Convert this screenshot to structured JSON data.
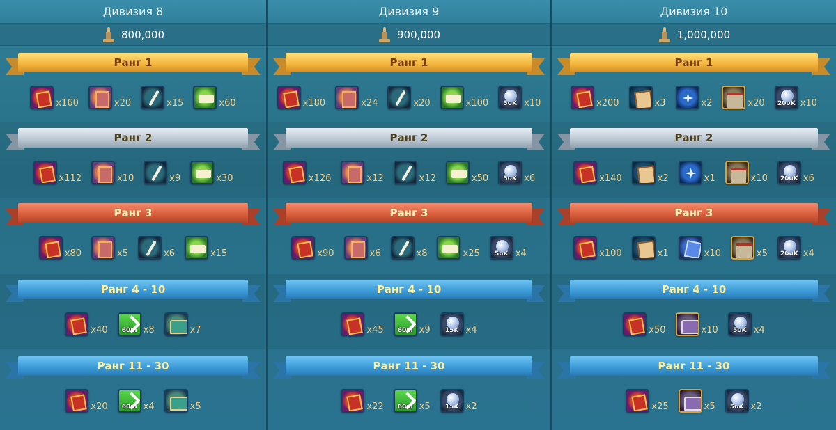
{
  "columns": [
    {
      "title": "Дивизия 8",
      "requirement": "800,000",
      "tiers": [
        {
          "label": "Ранг 1",
          "style": "gold",
          "items": [
            {
              "icon": "redbook",
              "qty": "x160"
            },
            {
              "icon": "pinkbook",
              "qty": "x20"
            },
            {
              "icon": "broom",
              "qty": "x15"
            },
            {
              "icon": "greenbook",
              "qty": "x60"
            }
          ]
        },
        {
          "label": "Ранг 2",
          "style": "silver",
          "items": [
            {
              "icon": "redbook",
              "qty": "x112"
            },
            {
              "icon": "pinkbook",
              "qty": "x10"
            },
            {
              "icon": "broom",
              "qty": "x9"
            },
            {
              "icon": "greenbook",
              "qty": "x30"
            }
          ]
        },
        {
          "label": "Ранг 3",
          "style": "bronze",
          "items": [
            {
              "icon": "redbook",
              "qty": "x80"
            },
            {
              "icon": "pinkbook",
              "qty": "x5"
            },
            {
              "icon": "broom",
              "qty": "x6"
            },
            {
              "icon": "greenbook",
              "qty": "x15"
            }
          ]
        },
        {
          "label": "Ранг 4 - 10",
          "style": "blue",
          "items": [
            {
              "icon": "redbook",
              "qty": "x40"
            },
            {
              "icon": "speed",
              "tag": "60m",
              "qty": "x8"
            },
            {
              "icon": "chest",
              "qty": "x7"
            }
          ]
        },
        {
          "label": "Ранг 11 - 30",
          "style": "blue",
          "items": [
            {
              "icon": "redbook",
              "qty": "x20"
            },
            {
              "icon": "speed",
              "tag": "60m",
              "qty": "x4"
            },
            {
              "icon": "chest",
              "qty": "x5"
            }
          ]
        }
      ]
    },
    {
      "title": "Дивизия 9",
      "requirement": "900,000",
      "tiers": [
        {
          "label": "Ранг 1",
          "style": "gold",
          "items": [
            {
              "icon": "redbook",
              "qty": "x180"
            },
            {
              "icon": "pinkbook",
              "qty": "x24"
            },
            {
              "icon": "broom",
              "qty": "x20"
            },
            {
              "icon": "greenbook",
              "qty": "x100"
            },
            {
              "icon": "crystal",
              "tag": "50K",
              "qty": "x10"
            }
          ]
        },
        {
          "label": "Ранг 2",
          "style": "silver",
          "items": [
            {
              "icon": "redbook",
              "qty": "x126"
            },
            {
              "icon": "pinkbook",
              "qty": "x12"
            },
            {
              "icon": "broom",
              "qty": "x12"
            },
            {
              "icon": "greenbook",
              "qty": "x50"
            },
            {
              "icon": "crystal",
              "tag": "50K",
              "qty": "x6"
            }
          ]
        },
        {
          "label": "Ранг 3",
          "style": "bronze",
          "items": [
            {
              "icon": "redbook",
              "qty": "x90"
            },
            {
              "icon": "pinkbook",
              "qty": "x6"
            },
            {
              "icon": "broom",
              "qty": "x8"
            },
            {
              "icon": "greenbook",
              "qty": "x25"
            },
            {
              "icon": "crystal",
              "tag": "50K",
              "qty": "x4"
            }
          ]
        },
        {
          "label": "Ранг 4 - 10",
          "style": "blue",
          "items": [
            {
              "icon": "redbook",
              "qty": "x45"
            },
            {
              "icon": "speed",
              "tag": "60m",
              "qty": "x9"
            },
            {
              "icon": "crystal",
              "tag": "15K",
              "qty": "x4"
            }
          ]
        },
        {
          "label": "Ранг 11 - 30",
          "style": "blue",
          "items": [
            {
              "icon": "redbook",
              "qty": "x22"
            },
            {
              "icon": "speed",
              "tag": "60m",
              "qty": "x5"
            },
            {
              "icon": "crystal",
              "tag": "15K",
              "qty": "x2"
            }
          ]
        }
      ]
    },
    {
      "title": "Дивизия 10",
      "requirement": "1,000,000",
      "tiers": [
        {
          "label": "Ранг 1",
          "style": "gold",
          "items": [
            {
              "icon": "redbook",
              "qty": "x200"
            },
            {
              "icon": "scroll",
              "qty": "x3"
            },
            {
              "icon": "star",
              "qty": "x2"
            },
            {
              "icon": "castle",
              "qty": "x20"
            },
            {
              "icon": "crystal",
              "tag": "200K",
              "qty": "x10"
            }
          ]
        },
        {
          "label": "Ранг 2",
          "style": "silver",
          "items": [
            {
              "icon": "redbook",
              "qty": "x140"
            },
            {
              "icon": "scroll",
              "qty": "x2"
            },
            {
              "icon": "star",
              "qty": "x1"
            },
            {
              "icon": "castle",
              "qty": "x10"
            },
            {
              "icon": "crystal",
              "tag": "200K",
              "qty": "x6"
            }
          ]
        },
        {
          "label": "Ранг 3",
          "style": "bronze",
          "items": [
            {
              "icon": "redbook",
              "qty": "x100"
            },
            {
              "icon": "scroll",
              "qty": "x1"
            },
            {
              "icon": "gem",
              "qty": "x10"
            },
            {
              "icon": "castle",
              "qty": "x5"
            },
            {
              "icon": "crystal",
              "tag": "200K",
              "qty": "x4"
            }
          ]
        },
        {
          "label": "Ранг 4 - 10",
          "style": "blue",
          "items": [
            {
              "icon": "redbook",
              "qty": "x50"
            },
            {
              "icon": "chest2",
              "qty": "x10"
            },
            {
              "icon": "crystal",
              "tag": "50K",
              "qty": "x4"
            }
          ]
        },
        {
          "label": "Ранг 11 - 30",
          "style": "blue",
          "items": [
            {
              "icon": "redbook",
              "qty": "x25"
            },
            {
              "icon": "chest2",
              "qty": "x5"
            },
            {
              "icon": "crystal",
              "tag": "50K",
              "qty": "x2"
            }
          ]
        }
      ]
    }
  ]
}
